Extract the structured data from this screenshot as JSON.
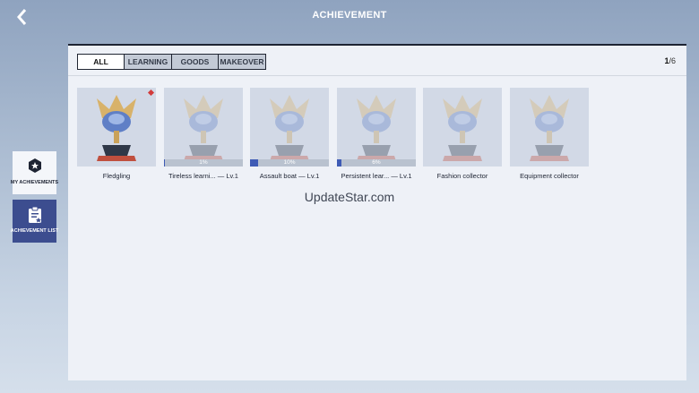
{
  "header": {
    "title": "ACHIEVEMENT"
  },
  "sidebar": {
    "my_achievements": "MY ACHIEVEMENTS",
    "achievement_list": "ACHIEVEMENT LIST"
  },
  "tabs": [
    {
      "label": "ALL"
    },
    {
      "label": "LEARNING"
    },
    {
      "label": "GOODS"
    },
    {
      "label": "MAKEOVER"
    }
  ],
  "pagination": {
    "current": "1",
    "total": "/6"
  },
  "achievements": [
    {
      "name": "Fledgling",
      "progress_label": ""
    },
    {
      "name": "Tireless learni...  — Lv.1",
      "progress_label": "1%"
    },
    {
      "name": "Assault boat — Lv.1",
      "progress_label": "10%"
    },
    {
      "name": "Persistent lear...  — Lv.1",
      "progress_label": "6%"
    },
    {
      "name": "Fashion collector",
      "progress_label": ""
    },
    {
      "name": "Equipment collector",
      "progress_label": ""
    }
  ],
  "watermark": "UpdateStar.com",
  "colors": {
    "accent": "#3c4d8f",
    "progress": "#3e5bb5",
    "badge": "#d23b3b"
  }
}
